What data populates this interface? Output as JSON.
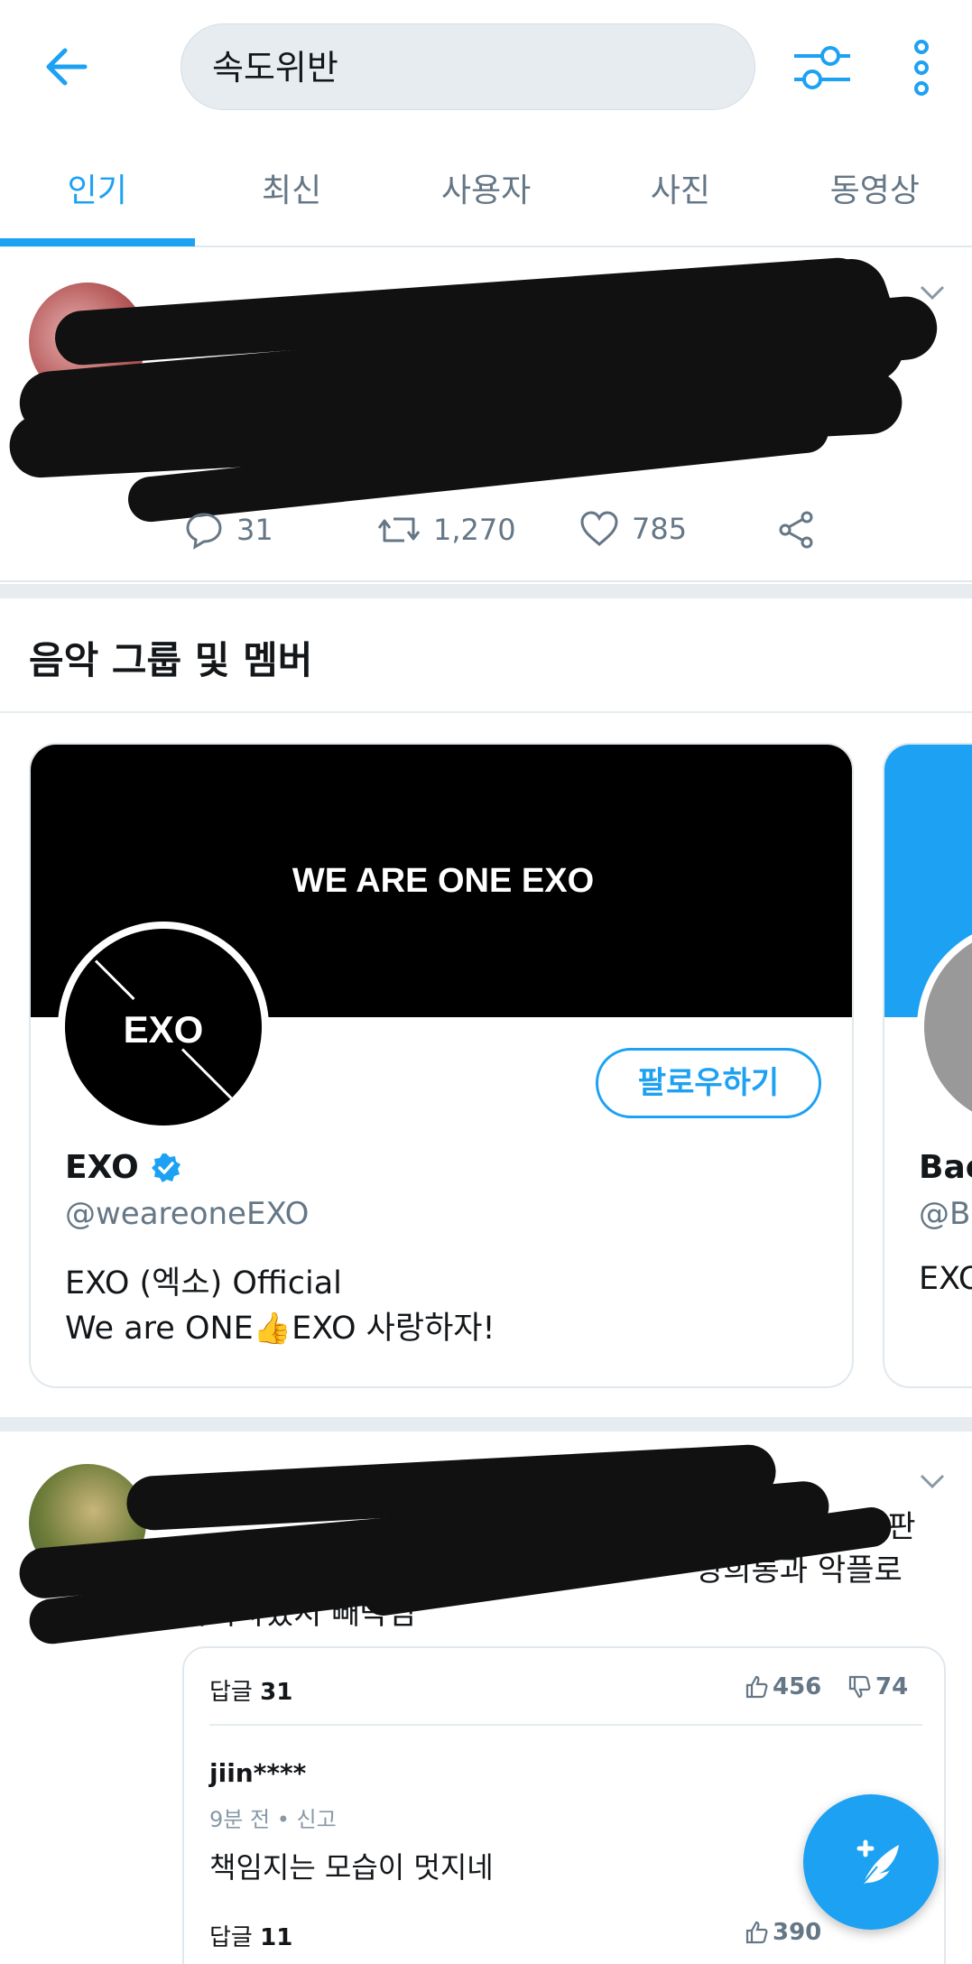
{
  "search": {
    "query": "속도위반"
  },
  "tabs": [
    {
      "label": "인기"
    },
    {
      "label": "최신"
    },
    {
      "label": "사용자"
    },
    {
      "label": "사진"
    },
    {
      "label": "동영상"
    }
  ],
  "tweet1": {
    "replies": "31",
    "retweets": "1,270",
    "likes": "785"
  },
  "section": {
    "title": "음악 그룹 및 멤버"
  },
  "card": {
    "banner_text": "WE ARE ONE EXO",
    "avatar_logo": "EXO",
    "follow_label": "팔로우하기",
    "name": "EXO",
    "handle": "@weareoneEXO",
    "bio_line1": "EXO (엑소) Official",
    "bio_line2_a": "We are ONE",
    "bio_line2_b": "EXO 사랑하자!"
  },
  "peek": {
    "name": "Bae",
    "handle": "@B",
    "bio": "EXO"
  },
  "tweet2": {
    "text_line1": "이판",
    "text_line2": "쌍희롱과 악플로",
    "text_line3": "가득차었지 빼박임",
    "embed": {
      "reply_label": "답글",
      "reply_count": "31",
      "up": "456",
      "down": "74",
      "commenter": "jiin****",
      "time": "9분 전",
      "report": "신고",
      "comment": "책임지는 모습이 멋지네",
      "reply_count2": "11",
      "up2": "390"
    }
  },
  "colors": {
    "accent": "#1da1f2",
    "muted": "#657786",
    "divider": "#e6ecf0"
  }
}
